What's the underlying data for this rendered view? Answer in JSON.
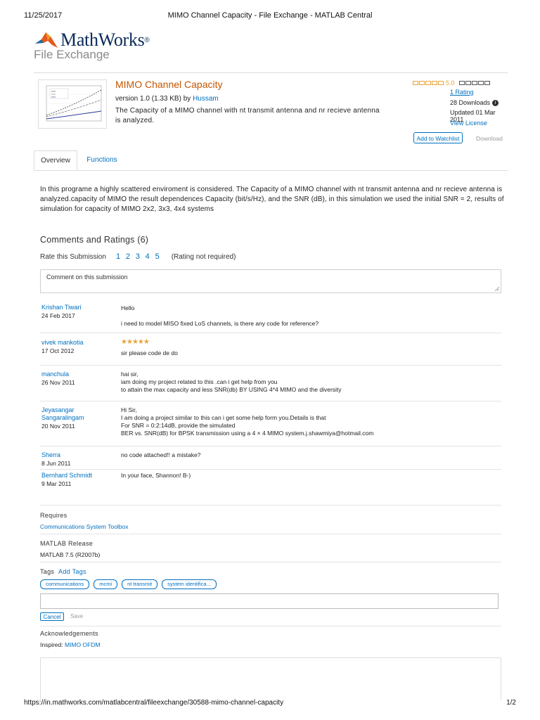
{
  "print_header": {
    "date": "11/25/2017",
    "title": "MIMO Channel Capacity - File Exchange - MATLAB Central"
  },
  "brand": {
    "name": "MathWorks",
    "registered": "®",
    "section": "File Exchange"
  },
  "submission": {
    "title": "MIMO Channel Capacity",
    "version_text": "version 1.0 (1.33 KB) by ",
    "author": "Hussam",
    "description": "The Capacity of a MIMO channel with nt transmit antenna and nr recieve antenna is analyzed.",
    "thumbnail_icon": "capacity-plot-thumbnail"
  },
  "sidebar": {
    "rating_value": "5.0",
    "rating_link": "1 Rating",
    "downloads": "28 Downloads",
    "updated": "Updated 01 Mar 2011",
    "license_link": "View License",
    "watchlist_button": "Add to Watchlist",
    "download_button": "Download"
  },
  "tabs": [
    {
      "label": "Overview"
    },
    {
      "label": "Functions"
    }
  ],
  "overview_text": "In this programe a highly scattered enviroment is considered. The Capacity of a MIMO channel with nt transmit antenna and nr recieve antenna is analyzed.capacity of MIMO the result dependences Capacity (bit/s/Hz), and the SNR (dB), in this simulation we used the initial SNR = 2, results of simulation for capacity of MIMO 2x2, 3x3, 4x4 systems",
  "comments_section": {
    "title": "Comments and Ratings (6)",
    "rate_label": "Rate this Submission",
    "rate_options": [
      "1",
      "2",
      "3",
      "4",
      "5"
    ],
    "rate_note": "(Rating not required)",
    "comment_placeholder": "Comment on this submission"
  },
  "comments": [
    {
      "author": "Krishan Tiwari",
      "date": "24 Feb 2017",
      "lines": [
        "Hello",
        "",
        "i need to model MISO fixed LoS channels, is there any code for reference?"
      ],
      "stars": 0
    },
    {
      "author": "vivek mankotia",
      "date": "17 Oct 2012",
      "lines": [
        "sir please code de do"
      ],
      "stars": 5
    },
    {
      "author": "manchula",
      "date": "26 Nov 2011",
      "lines": [
        "hai sir,",
        "iam doing my project related to this .can i get help from you",
        "to attain the max capacity and less SNR(db) BY USING 4*4 MIMO and the diversity"
      ],
      "stars": 0
    },
    {
      "author": "Jeyasangar Sangaralingam",
      "date": "20 Nov 2011",
      "lines": [
        "Hi Sir,",
        "I am doing a project similar to this can i get some help form you.Details is that",
        "For SNR = 0:2:14dB, provide the simulated",
        "BER vs. SNR(dB) for BPSK transmission using a 4 × 4 MIMO system.j.shawmiya@hotmail.com"
      ],
      "stars": 0
    },
    {
      "author": "Sherra",
      "date": "8 Jun 2011",
      "lines": [
        "no code attached!! a mistake?"
      ],
      "stars": 0
    },
    {
      "author": "Bernhard Schmidt",
      "date": "9 Mar 2011",
      "lines": [
        "In your face, Shannon! B-)"
      ],
      "stars": 0
    }
  ],
  "requires": {
    "label": "Requires",
    "value": "Communications System Toolbox"
  },
  "matlab_release": {
    "label": "MATLAB Release",
    "value": "MATLAB 7.5 (R2007b)"
  },
  "tags": {
    "label": "Tags",
    "add_link": "Add Tags",
    "items": [
      "communications",
      "mcmi",
      "nt transmit",
      "system identifica..."
    ],
    "cancel_button": "Cancel",
    "save_button": "Save"
  },
  "acknowledgements": {
    "label": "Acknowledgements",
    "inspired_label": "Inspired: ",
    "inspired_link": "MIMO OFDM"
  },
  "print_footer": {
    "url": "https://in.mathworks.com/matlabcentral/fileexchange/30588-mimo-channel-capacity",
    "page": "1/2"
  },
  "colors": {
    "accent_link": "#0070c0",
    "title_orange": "#c45500",
    "star_gold": "#e8a43a"
  }
}
